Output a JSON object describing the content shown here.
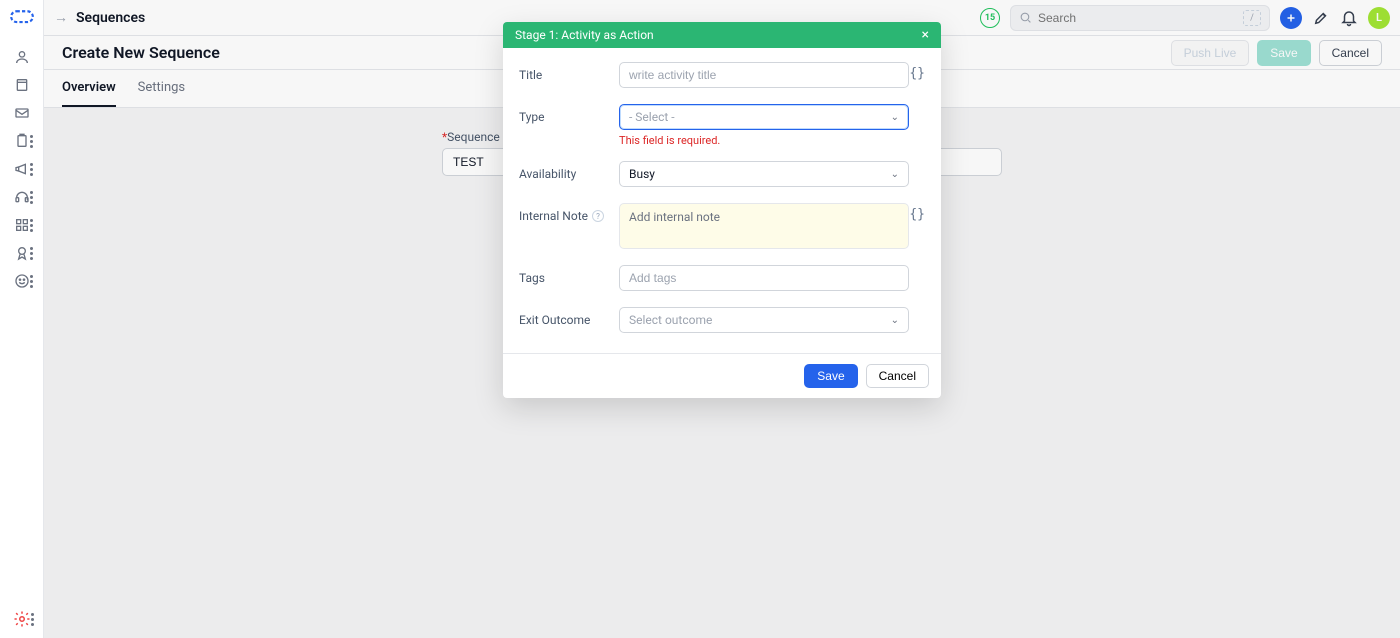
{
  "breadcrumb_title": "Sequences",
  "topbar": {
    "badge": "15",
    "search_placeholder": "Search",
    "search_shortcut": "/",
    "avatar_initial": "L"
  },
  "page": {
    "title": "Create New Sequence",
    "push_live_label": "Push Live",
    "save_label": "Save",
    "cancel_label": "Cancel",
    "tabs": [
      {
        "id": "overview",
        "label": "Overview",
        "active": true
      },
      {
        "id": "settings",
        "label": "Settings",
        "active": false
      }
    ],
    "bg_field_label": "Sequence",
    "bg_field_value": "TEST"
  },
  "modal": {
    "title": "Stage 1: Activity as Action",
    "fields": {
      "title_label": "Title",
      "title_placeholder": "write activity title",
      "type_label": "Type",
      "type_placeholder": "- Select -",
      "type_error": "This field is required.",
      "availability_label": "Availability",
      "availability_value": "Busy",
      "internal_note_label": "Internal Note",
      "internal_note_placeholder": "Add internal note",
      "tags_label": "Tags",
      "tags_placeholder": "Add tags",
      "exit_outcome_label": "Exit Outcome",
      "exit_outcome_placeholder": "Select outcome"
    },
    "save_label": "Save",
    "cancel_label": "Cancel"
  },
  "rail_icons": [
    "user",
    "book",
    "mail",
    "clipboard",
    "megaphone",
    "headset",
    "apps",
    "award",
    "smile"
  ]
}
